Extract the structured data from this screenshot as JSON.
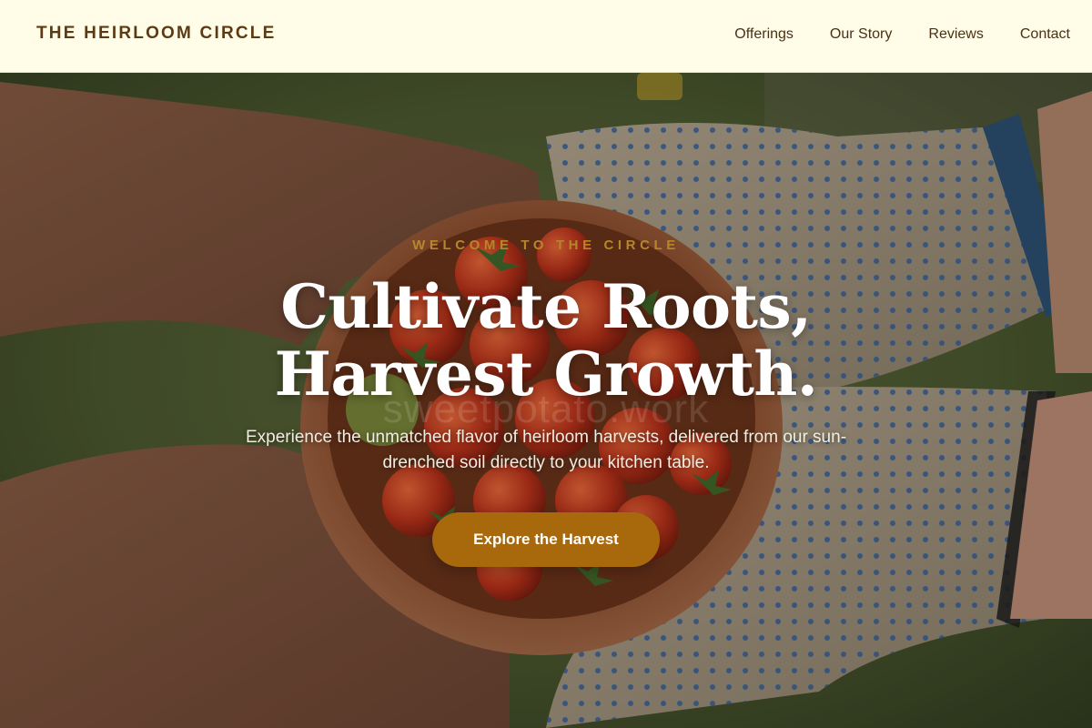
{
  "brand": {
    "name": "THE HEIRLOOM CIRCLE"
  },
  "nav": {
    "items": [
      {
        "label": "Offerings"
      },
      {
        "label": "Our Story"
      },
      {
        "label": "Reviews"
      },
      {
        "label": "Contact"
      }
    ]
  },
  "hero": {
    "eyebrow": "WELCOME TO THE CIRCLE",
    "headline_line1": "Cultivate Roots,",
    "headline_line2": "Harvest Growth.",
    "watermark": "sweetpotato.work",
    "subtext": "Experience the unmatched flavor of heirloom harvests, delivered from our sun-drenched soil directly to your kitchen table.",
    "cta_label": "Explore the Harvest",
    "image_subject": "hands-holding-bowl-of-cherry-tomatoes"
  },
  "colors": {
    "header_bg": "#FFFCE8",
    "brand_text": "#5C3B14",
    "eyebrow": "#B7862A",
    "cta_bg": "#A8690D",
    "headline": "#FFFFFF"
  }
}
